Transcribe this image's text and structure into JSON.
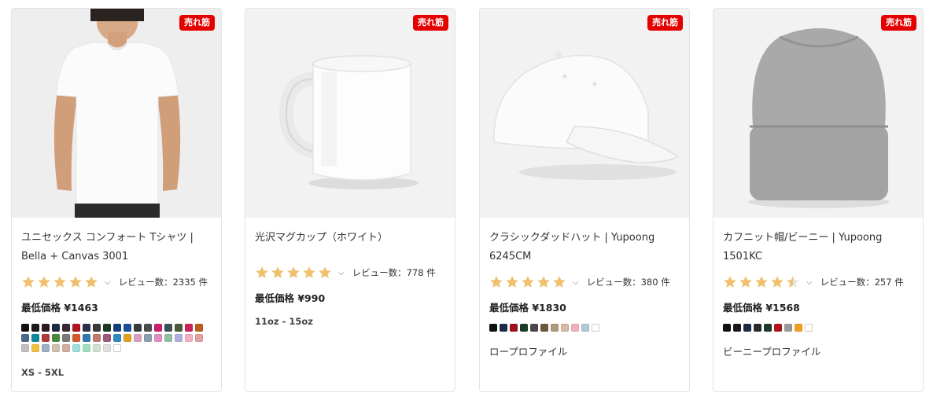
{
  "products": [
    {
      "badge": "売れ筋",
      "title": "ユニセックス コンフォート Tシャツ | Bella + Canvas 3001",
      "rating": 5,
      "reviews": "レビュー数：2335 件",
      "price": "最低価格 ¥1463",
      "variant_text": "XS - 5XL",
      "colors": [
        "#111111",
        "#1a1a1a",
        "#2b1b22",
        "#1f2a48",
        "#3a2a36",
        "#b3121f",
        "#2a2f4a",
        "#3a3a3a",
        "#1f3a25",
        "#12407a",
        "#1b4f9a",
        "#3a3a3a",
        "#4b4b4b",
        "#cc1f6e",
        "#3f4f57",
        "#4b5a3a",
        "#c8245a",
        "#c05a1e",
        "#4a6a8a",
        "#0f8a9a",
        "#b03a3a",
        "#4a8a3a",
        "#7a7a7a",
        "#d65a2e",
        "#2f7ab0",
        "#c07a6a",
        "#a05a7a",
        "#2f8ac0",
        "#e3a11e",
        "#d9a0c0",
        "#8aa0b0",
        "#e090c0",
        "#90c0a0",
        "#b0b0e0",
        "#f0b0c0",
        "#e7a0a0",
        "#c0c0c0",
        "#f0c040",
        "#a0b0c0",
        "#d0c0b0",
        "#d0b0a0",
        "#a0e0e0",
        "#a0e0c0",
        "#d0e0d0",
        "#e0e0e0",
        "#ffffff"
      ]
    },
    {
      "badge": "売れ筋",
      "title": "光沢マグカップ（ホワイト）",
      "rating": 5,
      "reviews": "レビュー数：778 件",
      "price": "最低価格 ¥990",
      "variant_text": "11oz - 15oz",
      "colors": []
    },
    {
      "badge": "売れ筋",
      "title": "クラシックダッドハット | Yupoong 6245CM",
      "rating": 5,
      "reviews": "レビュー数：380 件",
      "price": "最低価格 ¥1830",
      "variant_text": "ロープロファイル",
      "colors": [
        "#111111",
        "#1f2a48",
        "#a0101e",
        "#1f3a25",
        "#4a4a4a",
        "#6b5a3a",
        "#b09a7a",
        "#d9b9a0",
        "#f0b0c0",
        "#b0c8d8",
        "#ffffff"
      ]
    },
    {
      "badge": "売れ筋",
      "title": "カフニット帽/ビーニー | Yupoong 1501KC",
      "rating": 4.5,
      "reviews": "レビュー数：257 件",
      "price": "最低価格 ¥1568",
      "variant_text": "ビーニープロファイル",
      "colors": [
        "#111111",
        "#1a1a1a",
        "#1f2a48",
        "#2a2a2a",
        "#1f3a25",
        "#b3121f",
        "#9a9a9a",
        "#f0a020",
        "#ffffff"
      ]
    }
  ],
  "colors": {
    "star": "#f0c070",
    "badge_bg": "#e50000"
  },
  "icons": {
    "star": "star-icon",
    "chevron": "chevron-down-icon"
  }
}
